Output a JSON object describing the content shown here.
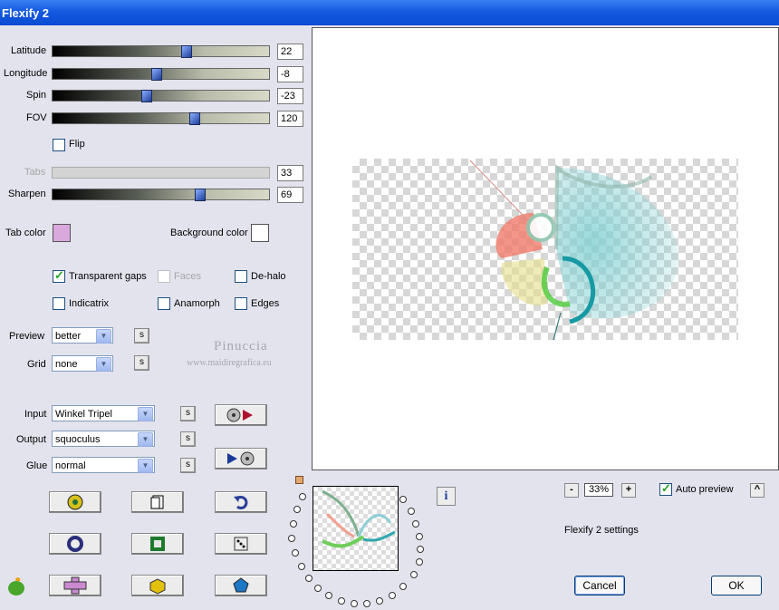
{
  "window": {
    "title": "Flexify 2"
  },
  "sliders": [
    {
      "label": "Latitude",
      "value": "22",
      "fraction": 0.62
    },
    {
      "label": "Longitude",
      "value": "-8",
      "fraction": 0.47
    },
    {
      "label": "Spin",
      "value": "-23",
      "fraction": 0.43
    },
    {
      "label": "FOV",
      "value": "120",
      "fraction": 0.66
    }
  ],
  "flip": {
    "label": "Flip",
    "checked": false
  },
  "tabs": {
    "label": "Tabs",
    "value": "33",
    "enabled": false
  },
  "sharpen": {
    "label": "Sharpen",
    "value": "69",
    "fraction": 0.68
  },
  "tab_color": {
    "label": "Tab color",
    "color": "#D9A8DD"
  },
  "background_color": {
    "label": "Background color",
    "color": "#FFFFFF"
  },
  "options": {
    "transparent_gaps": {
      "label": "Transparent gaps",
      "checked": true
    },
    "faces": {
      "label": "Faces",
      "checked": false,
      "enabled": false
    },
    "de_halo": {
      "label": "De-halo",
      "checked": false
    },
    "indicatrix": {
      "label": "Indicatrix",
      "checked": false
    },
    "anamorph": {
      "label": "Anamorph",
      "checked": false
    },
    "edges": {
      "label": "Edges",
      "checked": false
    }
  },
  "preview_select": {
    "label": "Preview",
    "value": "better"
  },
  "grid_select": {
    "label": "Grid",
    "value": "none"
  },
  "input_select": {
    "label": "Input",
    "value": "Winkel Tripel"
  },
  "output_select": {
    "label": "Output",
    "value": "squoculus"
  },
  "glue_select": {
    "label": "Glue",
    "value": "normal"
  },
  "s_label": "s",
  "watermark": {
    "name": "Pinuccia",
    "site": "www.maidiregrafica.eu"
  },
  "zoom": {
    "value": "33%",
    "minus": "-",
    "plus": "+"
  },
  "auto_preview": {
    "label": "Auto preview",
    "checked": true
  },
  "settings_label": "Flexify 2 settings",
  "cancel_label": "Cancel",
  "ok_label": "OK",
  "info_label": "i",
  "up_label": "^",
  "colors": {
    "accent": "#0A4BD4",
    "slider_thumb": "#2E56C2"
  }
}
